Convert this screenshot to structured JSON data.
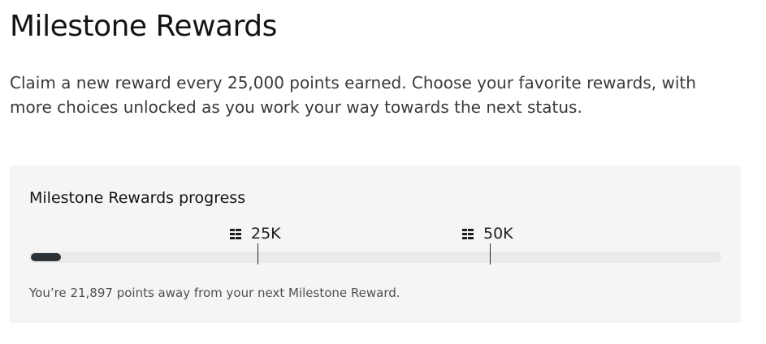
{
  "header": {
    "title": "Milestone Rewards",
    "description": "Claim a new reward every 25,000 points earned. Choose your favorite rewards, with more choices unlocked as you work your way towards the next status."
  },
  "progress_card": {
    "title": "Milestone Rewards progress",
    "progress_fraction": 0.044,
    "milestones": [
      {
        "label": "25K",
        "icon": "reward-icon",
        "fraction": 0.33
      },
      {
        "label": "50K",
        "icon": "reward-icon",
        "fraction": 0.665
      }
    ],
    "status_text": "You’re 21,897 points away from your next Milestone Reward."
  },
  "colors": {
    "card_background": "#f5f5f5",
    "track": "#eaeaea",
    "fill": "#2e3338",
    "text": "#1b1b1b",
    "muted_text": "#505050"
  }
}
